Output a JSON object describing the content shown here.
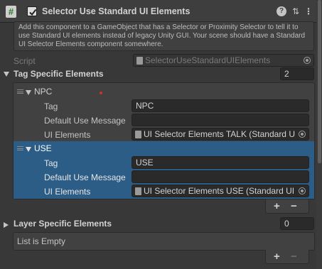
{
  "component": {
    "title": "Selector Use Standard UI Elements",
    "icon": "script-hash-icon",
    "enabled": true
  },
  "help_text": "Add this component to a GameObject that has a Selector or Proximity Selector to tell it to use Standard UI elements instead of legacy Unity GUI. Your scene should have a Standard UI Selector Elements component somewhere.",
  "script": {
    "label": "Script",
    "value": "SelectorUseStandardUIElements"
  },
  "tag_specific": {
    "label": "Tag Specific Elements",
    "count": "2",
    "items": [
      {
        "header": "NPC",
        "tag_label": "Tag",
        "tag_value": "NPC",
        "default_msg_label": "Default Use Message",
        "default_msg_value": "",
        "ui_label": "UI Elements",
        "ui_value": "UI Selector Elements TALK (Standard U"
      },
      {
        "header": "USE",
        "tag_label": "Tag",
        "tag_value": "USE",
        "default_msg_label": "Default Use Message",
        "default_msg_value": "",
        "ui_label": "UI Elements",
        "ui_value": "UI Selector Elements USE (Standard UI"
      }
    ]
  },
  "layer_specific": {
    "label": "Layer Specific Elements",
    "count": "0",
    "empty_text": "List is Empty"
  },
  "buttons": {
    "plus": "+",
    "minus": "−"
  },
  "header_icons": {
    "help": "?",
    "settings": "⇅",
    "menu": "⋮"
  },
  "colors": {
    "selection": "#2c5d87",
    "accent_dot": "#d03030"
  }
}
